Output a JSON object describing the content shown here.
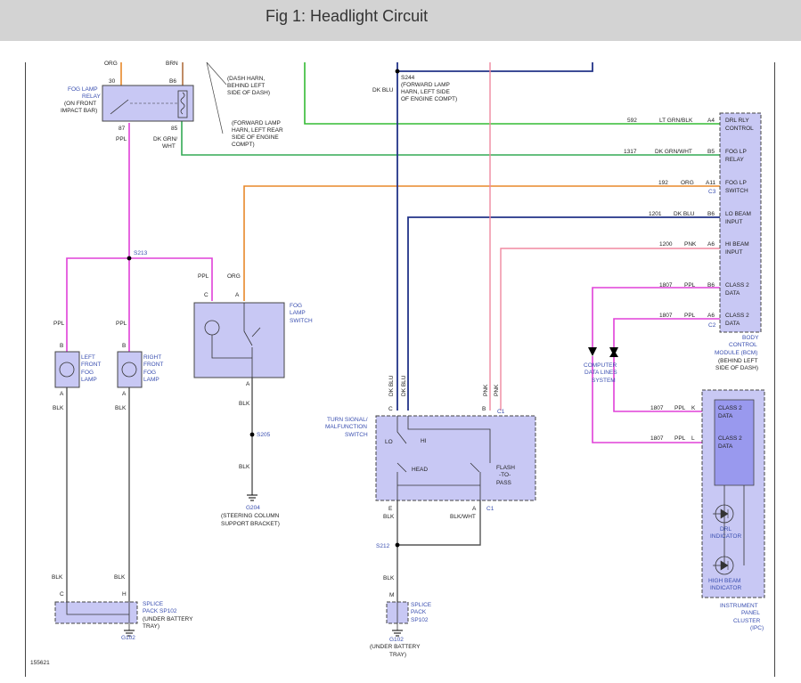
{
  "title": "Fig 1: Headlight Circuit",
  "figure_id": "155621",
  "colors": {
    "header_bg": "#d3d3d3",
    "component_fill": "#c8c8f4",
    "dark_fill": "#9999ee",
    "wire_org": "#e8892a",
    "wire_green": "#33bb33",
    "wire_blue": "#223388",
    "wire_ppl": "#e040d8",
    "wire_pnk": "#f088a0",
    "wire_blk": "#555555"
  },
  "top": {
    "org": "ORG",
    "brn": "BRN",
    "pin30": "30",
    "pinB6": "B6",
    "dash_harn_1": "(DASH HARN,",
    "dash_harn_2": "BEHIND LEFT",
    "dash_harn_3": "SIDE OF DASH)",
    "fwd_lamp_1": "(FORWARD LAMP",
    "fwd_lamp_2": "HARN, LEFT REAR",
    "fwd_lamp_3": "SIDE OF ENGINE",
    "fwd_lamp_4": "COMPT)",
    "s244": "S244",
    "s244_1": "(FORWARD LAMP",
    "s244_2": "HARN, LEFT SIDE",
    "s244_3": "OF ENGINE COMPT)",
    "dk_blu": "DK BLU"
  },
  "fog_relay": {
    "l1": "FOG LAMP",
    "l2": "RELAY",
    "l3": "(ON FRONT",
    "l4": "IMPACT BAR)",
    "pin87": "87",
    "pin85": "85",
    "ppl": "PPL",
    "dkgrn1": "DK GRN/",
    "dkgrn2": "WHT"
  },
  "bcm": {
    "rows": [
      {
        "circuit": "592",
        "wire": "LT GRN/BLK",
        "pin": "A4",
        "l1": "DRL RLY",
        "l2": "CONTROL"
      },
      {
        "circuit": "1317",
        "wire": "DK GRN/WHT",
        "pin": "B5",
        "l1": "FOG LP",
        "l2": "RELAY"
      },
      {
        "circuit": "192",
        "wire": "ORG",
        "pin": "A11",
        "l1": "FOG LP",
        "l2": "SWITCH"
      },
      {
        "circuit": "1201",
        "wire": "DK BLU",
        "pin": "B6",
        "l1": "LO BEAM",
        "l2": "INPUT"
      },
      {
        "circuit": "1200",
        "wire": "PNK",
        "pin": "A6",
        "l1": "HI BEAM",
        "l2": "INPUT"
      },
      {
        "circuit": "1807",
        "wire": "PPL",
        "pin": "B6",
        "l1": "CLASS 2",
        "l2": "DATA"
      },
      {
        "circuit": "1807",
        "wire": "PPL",
        "pin": "A6",
        "l1": "CLASS 2",
        "l2": "DATA"
      }
    ],
    "c3": "C3",
    "c2": "C2",
    "l1": "BODY",
    "l2": "CONTROL",
    "l3": "MODULE (BCM)",
    "l4": "(BEHIND LEFT",
    "l5": "SIDE OF DASH)"
  },
  "computer_data": {
    "l1": "COMPUTER",
    "l2": "DATA LINES",
    "l3": "SYSTEM"
  },
  "ipc": {
    "row1": {
      "circuit": "1807",
      "wire": "PPL",
      "pin": "K",
      "l1": "CLASS 2",
      "l2": "DATA"
    },
    "row2": {
      "circuit": "1807",
      "wire": "PPL",
      "pin": "L",
      "l1": "CLASS 2",
      "l2": "DATA"
    },
    "drl1": "DRL",
    "drl2": "INDICATOR",
    "hb1": "HIGH BEAM",
    "hb2": "INDICATOR",
    "l1": "INSTRUMENT",
    "l2": "PANEL",
    "l3": "CLUSTER",
    "l4": "(IPC)"
  },
  "s213": "S213",
  "lamps": {
    "ppl": "PPL",
    "pinB": "B",
    "pinA": "A",
    "blk": "BLK",
    "left": {
      "l1": "LEFT",
      "l2": "FRONT",
      "l3": "FOG",
      "l4": "LAMP"
    },
    "right": {
      "l1": "RIGHT",
      "l2": "FRONT",
      "l3": "FOG",
      "l4": "LAMP"
    }
  },
  "fog_switch": {
    "ppl": "PPL",
    "org": "ORG",
    "pinC": "C",
    "pinA": "A",
    "pinA2": "A",
    "l1": "FOG",
    "l2": "LAMP",
    "l3": "SWITCH",
    "blk": "BLK",
    "s205": "S205",
    "blk2": "BLK",
    "g204": "G204",
    "g204_1": "(STEERING COLUMN",
    "g204_2": "SUPPORT BRACKET)"
  },
  "splice_left": {
    "blk": "BLK",
    "pinC": "C",
    "pinH": "H",
    "l1": "SPLICE",
    "l2": "PACK SP102",
    "l3": "(UNDER BATTERY",
    "l4": "TRAY)",
    "g102": "G102"
  },
  "turn_switch": {
    "dkblu": "DK BLU",
    "pnk": "PNK",
    "pinC": "C",
    "pinB": "B",
    "c1": "C1",
    "l1": "TURN SIGNAL/",
    "l2": "MALFUNCTION",
    "l3": "SWITCH",
    "lo": "LO",
    "hi": "HI",
    "head": "HEAD",
    "flash1": "FLASH",
    "flash2": "-TO-",
    "flash3": "PASS",
    "pinE": "E",
    "pinA": "A",
    "c1b": "C1",
    "blk": "BLK",
    "blkwht": "BLK/WHT",
    "s212": "S212",
    "blk2": "BLK"
  },
  "splice_mid": {
    "pinM": "M",
    "l1": "SPLICE",
    "l2": "PACK",
    "l3": "SP102",
    "g102": "G102",
    "g1": "(UNDER BATTERY",
    "g2": "TRAY)"
  }
}
